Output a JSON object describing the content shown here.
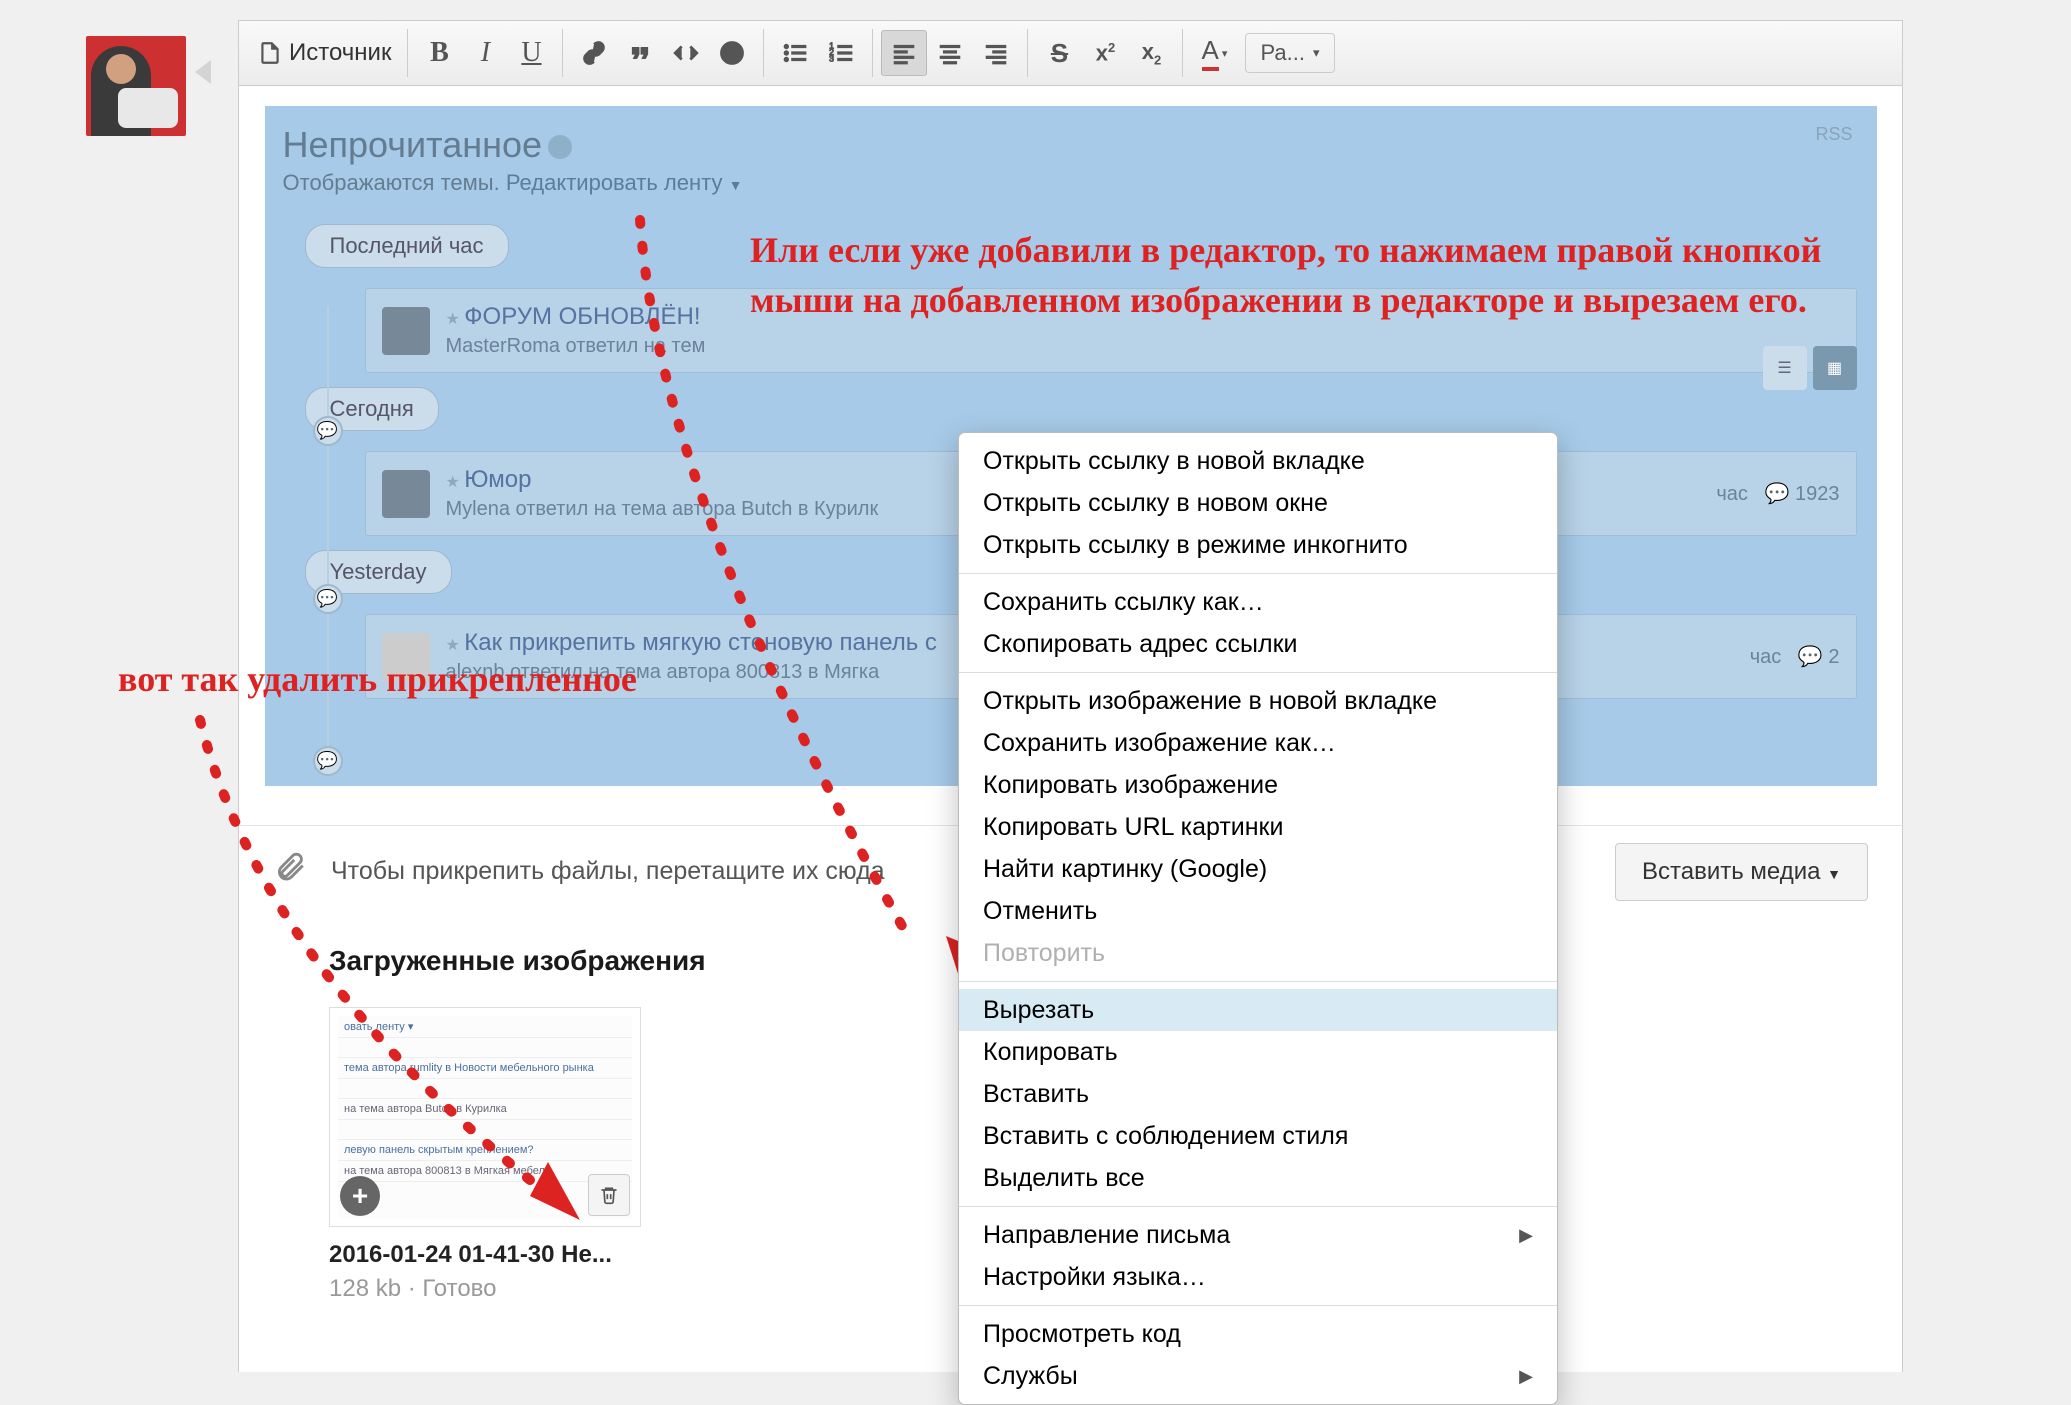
{
  "toolbar": {
    "source_label": "Источник",
    "size_label": "Ра..."
  },
  "forum": {
    "title": "Непрочитанное",
    "subtitle_a": "Отображаются темы.",
    "subtitle_b": "Редактировать ленту",
    "rss": "RSS",
    "pill_hour": "Последний час",
    "pill_today": "Сегодня",
    "pill_yesterday": "Yesterday",
    "post1_title": "ФОРУМ ОБНОВЛЁН!",
    "post1_sub": "MasterRoma ответил на тем",
    "post2_title": "Юмор",
    "post2_sub": "Mylena ответил на тема автора Butch в Курилк",
    "post2_meta_time": "час",
    "post2_meta_replies": "1923",
    "post3_title": "Как прикрепить мягкую стеновую панель с",
    "post3_sub": "alexnb ответил на тема автора 800813 в Мягка",
    "post3_meta_time": "час",
    "post3_meta_replies": "2"
  },
  "annotation": {
    "right": "Или если уже добавили в редактор, то нажимаем правой кнопкой мыши на добавленном изображении в редакторе и вырезаем его.",
    "left": "вот так удалить прикрепленное"
  },
  "attach": {
    "text": "Чтобы прикрепить файлы, перетащите их сюда",
    "insert": "Вставить медиа"
  },
  "uploads": {
    "title": "Загруженные изображения",
    "filename": "2016-01-24 01-41-30 Не...",
    "meta": "128 kb · Готово",
    "mini_line1": "овать ленту ▾",
    "mini_line2": "тема автора rumlity в Новости мебельного рынка",
    "mini_line3": "на тема автора Butch в Курилка",
    "mini_line4": "левую панель скрытым креплением?",
    "mini_line5": "на тема автора 800813 в Мягкая мебель"
  },
  "context_menu": {
    "items": [
      {
        "label": "Открыть ссылку в новой вкладке",
        "disabled": false
      },
      {
        "label": "Открыть ссылку в новом окне",
        "disabled": false
      },
      {
        "label": "Открыть ссылку в режиме инкогнито",
        "disabled": false
      },
      {
        "sep": true
      },
      {
        "label": "Сохранить ссылку как…",
        "disabled": false
      },
      {
        "label": "Скопировать адрес ссылки",
        "disabled": false
      },
      {
        "sep": true
      },
      {
        "label": "Открыть изображение в новой вкладке",
        "disabled": false
      },
      {
        "label": "Сохранить изображение как…",
        "disabled": false
      },
      {
        "label": "Копировать изображение",
        "disabled": false
      },
      {
        "label": "Копировать URL картинки",
        "disabled": false
      },
      {
        "label": "Найти картинку (Google)",
        "disabled": false
      },
      {
        "label": "Отменить",
        "disabled": false
      },
      {
        "label": "Повторить",
        "disabled": true
      },
      {
        "sep": true
      },
      {
        "label": "Вырезать",
        "disabled": false,
        "hl": true
      },
      {
        "label": "Копировать",
        "disabled": false
      },
      {
        "label": "Вставить",
        "disabled": false
      },
      {
        "label": "Вставить с соблюдением стиля",
        "disabled": false
      },
      {
        "label": "Выделить все",
        "disabled": false
      },
      {
        "sep": true
      },
      {
        "label": "Направление письма",
        "disabled": false,
        "submenu": true
      },
      {
        "label": "Настройки языка…",
        "disabled": false
      },
      {
        "sep": true
      },
      {
        "label": "Просмотреть код",
        "disabled": false
      },
      {
        "label": "Службы",
        "disabled": false,
        "submenu": true
      }
    ]
  }
}
